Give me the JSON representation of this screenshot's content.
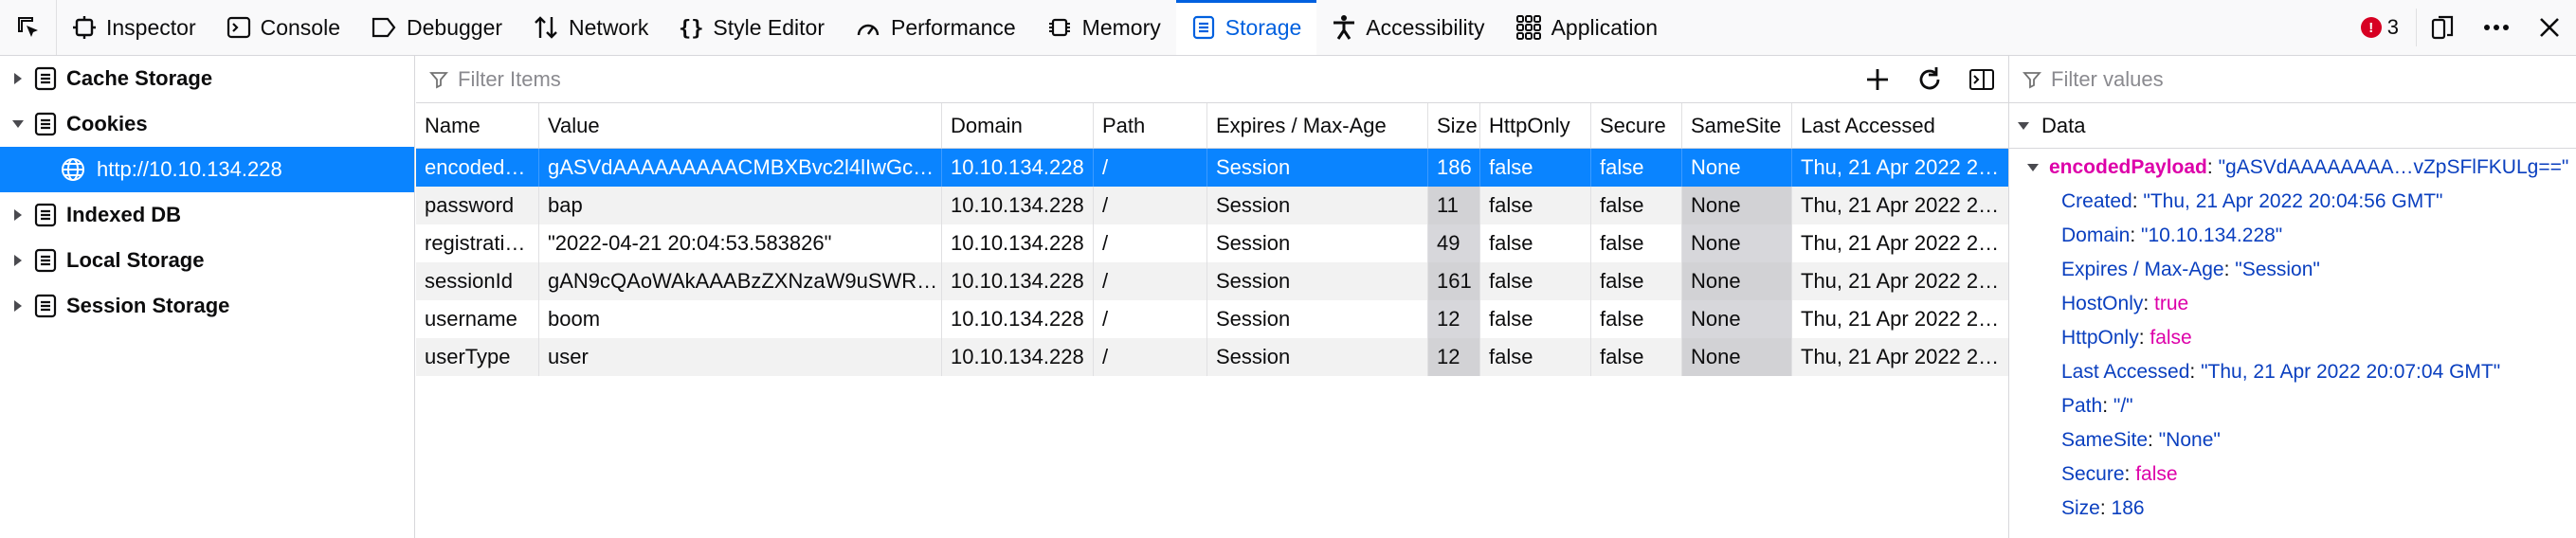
{
  "toolbar": {
    "tabs": [
      {
        "label": "Inspector",
        "icon": "inspector-icon"
      },
      {
        "label": "Console",
        "icon": "console-icon"
      },
      {
        "label": "Debugger",
        "icon": "debugger-icon"
      },
      {
        "label": "Network",
        "icon": "network-icon"
      },
      {
        "label": "Style Editor",
        "icon": "style-editor-icon"
      },
      {
        "label": "Performance",
        "icon": "performance-icon"
      },
      {
        "label": "Memory",
        "icon": "memory-icon"
      },
      {
        "label": "Storage",
        "icon": "storage-icon"
      },
      {
        "label": "Accessibility",
        "icon": "accessibility-icon"
      },
      {
        "label": "Application",
        "icon": "application-icon"
      }
    ],
    "selected_tab": "Storage",
    "error_count": "3"
  },
  "sidebar": {
    "items": [
      {
        "label": "Cache Storage",
        "expanded": false
      },
      {
        "label": "Cookies",
        "expanded": true
      },
      {
        "label": "http://10.10.134.228",
        "selected": true
      },
      {
        "label": "Indexed DB",
        "expanded": false
      },
      {
        "label": "Local Storage",
        "expanded": false
      },
      {
        "label": "Session Storage",
        "expanded": false
      }
    ]
  },
  "table": {
    "filter_placeholder": "Filter Items",
    "columns": [
      "Name",
      "Value",
      "Domain",
      "Path",
      "Expires / Max-Age",
      "Size",
      "HttpOnly",
      "Secure",
      "SameSite",
      "Last Accessed"
    ],
    "rows": [
      [
        "encoded…",
        "gASVdAAAAAAAAACMBXBvc2l4lIwGc3…",
        "10.10.134.228",
        "/",
        "Session",
        "186",
        "false",
        "false",
        "None",
        "Thu, 21 Apr 2022 2…"
      ],
      [
        "password",
        "bap",
        "10.10.134.228",
        "/",
        "Session",
        "11",
        "false",
        "false",
        "None",
        "Thu, 21 Apr 2022 2…"
      ],
      [
        "registrati…",
        "\"2022-04-21 20:04:53.583826\"",
        "10.10.134.228",
        "/",
        "Session",
        "49",
        "false",
        "false",
        "None",
        "Thu, 21 Apr 2022 2…"
      ],
      [
        "sessionId",
        "gAN9cQAoWAkAAABzZXNzaW9uSWR…",
        "10.10.134.228",
        "/",
        "Session",
        "161",
        "false",
        "false",
        "None",
        "Thu, 21 Apr 2022 2…"
      ],
      [
        "username",
        "boom",
        "10.10.134.228",
        "/",
        "Session",
        "12",
        "false",
        "false",
        "None",
        "Thu, 21 Apr 2022 2…"
      ],
      [
        "userType",
        "user",
        "10.10.134.228",
        "/",
        "Session",
        "12",
        "false",
        "false",
        "None",
        "Thu, 21 Apr 2022 2…"
      ]
    ]
  },
  "data_pane": {
    "filter_placeholder": "Filter values",
    "header": "Data",
    "root_key": "encodedPayload",
    "root_value": "\"gASVdAAAAAAAA…vZpSFlFKULg==\"",
    "props": [
      {
        "key": "Created",
        "value": "\"Thu, 21 Apr 2022 20:04:56 GMT\"",
        "kind": "string"
      },
      {
        "key": "Domain",
        "value": "\"10.10.134.228\"",
        "kind": "string"
      },
      {
        "key": "Expires / Max-Age",
        "value": "\"Session\"",
        "kind": "string"
      },
      {
        "key": "HostOnly",
        "value": "true",
        "kind": "bool"
      },
      {
        "key": "HttpOnly",
        "value": "false",
        "kind": "bool"
      },
      {
        "key": "Last Accessed",
        "value": "\"Thu, 21 Apr 2022 20:07:04 GMT\"",
        "kind": "string"
      },
      {
        "key": "Path",
        "value": "\"/\"",
        "kind": "string"
      },
      {
        "key": "SameSite",
        "value": "\"None\"",
        "kind": "string"
      },
      {
        "key": "Secure",
        "value": "false",
        "kind": "bool"
      },
      {
        "key": "Size",
        "value": "186",
        "kind": "number"
      }
    ]
  },
  "colors": {
    "accent": "#0060df",
    "selection": "#0a84ff",
    "error": "#d70022",
    "bool": "#dd00a9"
  }
}
